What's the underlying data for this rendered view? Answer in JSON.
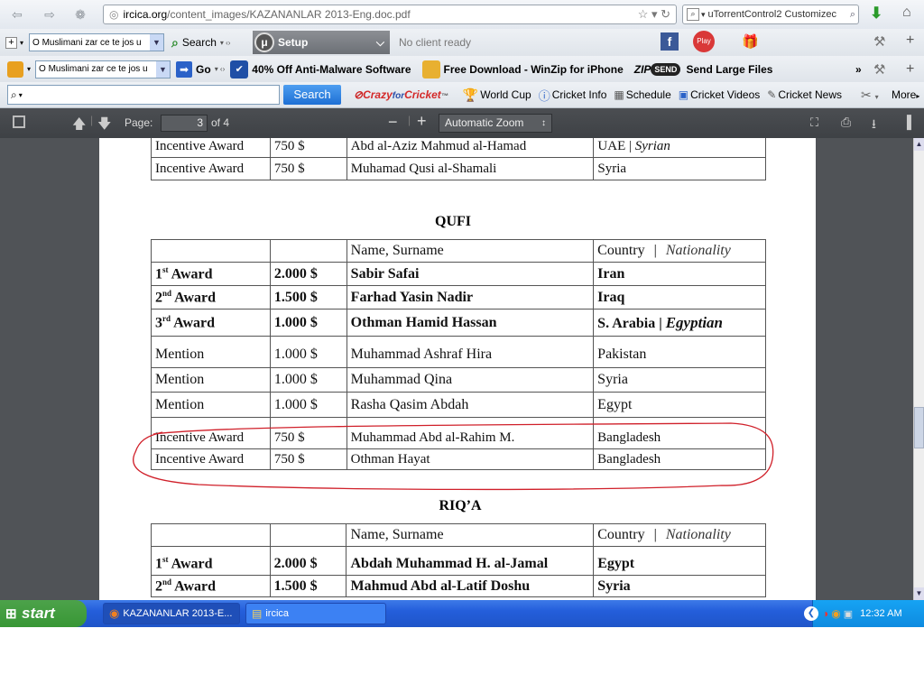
{
  "browser": {
    "url_host": "ircica.org",
    "url_path": "/content_images/KAZANANLAR 2013-Eng.doc.pdf",
    "search_engine_text": "uTorrentControl2 Customizec"
  },
  "toolbar1": {
    "dropdown_value": "O Muslimani zar ce te jos u",
    "search_label": "Search",
    "setup_label": "Setup",
    "status": "No client ready"
  },
  "toolbar2": {
    "dropdown_value": "O Muslimani zar ce te jos u",
    "go_label": "Go",
    "link_malware": "40% Off Anti-Malware Software",
    "link_winzip": "Free Download - WinZip for iPhone",
    "link_yousend": "Send Large Files"
  },
  "toolbar3": {
    "search_button": "Search",
    "brand_crazy": "Crazy",
    "brand_for": "for",
    "brand_cricket": "Cricket",
    "brand_tm": "™",
    "links": [
      "World Cup",
      "Cricket Info",
      "Schedule",
      "Cricket Videos",
      "Cricket News"
    ],
    "more_label": "More"
  },
  "pdf_toolbar": {
    "page_label": "Page:",
    "page_current": "3",
    "page_total": "of 4",
    "zoom": "Automatic Zoom"
  },
  "document": {
    "top_rows": [
      {
        "award": "Incentive Award",
        "prize": "750 $",
        "name": "Abd al-Aziz Mahmud al-Hamad",
        "country": "UAE",
        "nationality": "Syrian"
      },
      {
        "award": "Incentive Award",
        "prize": "750 $",
        "name": "Muhamad Qusi al-Shamali",
        "country": "Syria",
        "nationality": ""
      }
    ],
    "qufi": {
      "title": "QUFI",
      "header": {
        "name": "Name, Surname",
        "country": "Country",
        "sep": "|",
        "nationality": "Nationality"
      },
      "rows": [
        {
          "award": "1",
          "sup": "st",
          "award_rest": " Award",
          "prize": "2.000 $",
          "name": "Sabir Safai",
          "country": "Iran",
          "nationality": ""
        },
        {
          "award": "2",
          "sup": "nd",
          "award_rest": " Award",
          "prize": "1.500 $",
          "name": "Farhad Yasin Nadir",
          "country": "Iraq",
          "nationality": ""
        },
        {
          "award": "3",
          "sup": "rd",
          "award_rest": " Award",
          "prize": "1.000 $",
          "name": "Othman Hamid Hassan",
          "country": "S. Arabia",
          "nationality": "Egyptian"
        },
        {
          "award": "Mention",
          "prize": "1.000 $",
          "name": "Muhammad Ashraf Hira",
          "country": "Pakistan",
          "nationality": ""
        },
        {
          "award": "Mention",
          "prize": "1.000 $",
          "name": "Muhammad Qina",
          "country": "Syria",
          "nationality": ""
        },
        {
          "award": "Mention",
          "prize": "1.000 $",
          "name": "Rasha Qasim Abdah",
          "country": "Egypt",
          "nationality": ""
        },
        {
          "award": "Incentive Award",
          "prize": "750 $",
          "name": "Muhammad Abd al-Rahim M.",
          "country": "Bangladesh",
          "nationality": ""
        },
        {
          "award": "Incentive Award",
          "prize": "750 $",
          "name": "Othman Hayat",
          "country": "Bangladesh",
          "nationality": ""
        }
      ]
    },
    "riqa": {
      "title": "RIQ’A",
      "header": {
        "name": "Name, Surname",
        "country": "Country",
        "sep": "|",
        "nationality": "Nationality"
      },
      "rows": [
        {
          "award": "1",
          "sup": "st",
          "award_rest": " Award",
          "prize": "2.000 $",
          "name": "Abdah Muhammad H. al-Jamal",
          "country": "Egypt"
        },
        {
          "award": "2",
          "sup": "nd",
          "award_rest": " Award",
          "prize": "1.500 $",
          "name": "Mahmud Abd al-Latif Doshu",
          "country": "Syria"
        }
      ]
    }
  },
  "taskbar": {
    "start": "start",
    "tasks": [
      "KAZANANLAR 2013-E...",
      "ircica"
    ],
    "clock": "12:32 AM"
  },
  "colors": {
    "annotation": "#d0202a",
    "pdf_toolbar": "#45484c",
    "taskbar": "#245edb"
  }
}
